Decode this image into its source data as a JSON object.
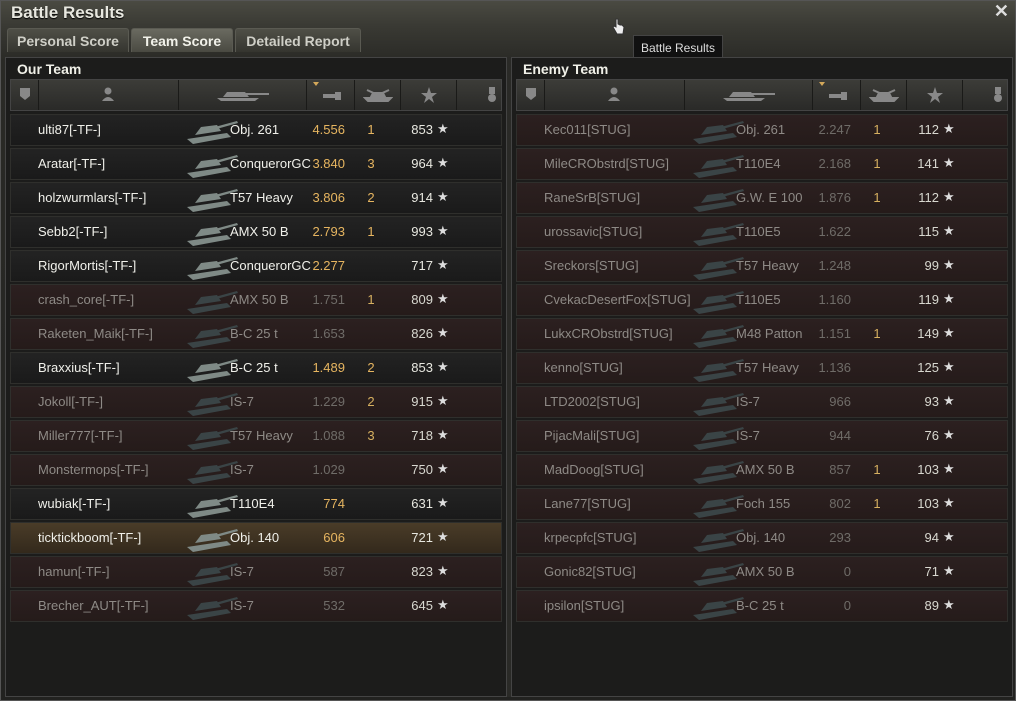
{
  "window": {
    "title": "Battle Results",
    "close_icon": "close-icon"
  },
  "tabs": [
    {
      "label": "Personal Score",
      "active": false
    },
    {
      "label": "Team Score",
      "active": true
    },
    {
      "label": "Detailed Report",
      "active": false
    }
  ],
  "tooltip": "Battle Results",
  "columns": {
    "icons": [
      "tier-badge-icon",
      "player-icon",
      "tank-icon",
      "damage-icon",
      "kills-icon",
      "xp-star-icon",
      "medal-icon"
    ],
    "sorted_by": "damage"
  },
  "our_team": {
    "title": "Our Team",
    "players": [
      {
        "name": "ulti87[-TF-]",
        "tank": "Obj. 261",
        "damage": "4.556",
        "kills": "1",
        "xp": "853",
        "state": "alive"
      },
      {
        "name": "Aratar[-TF-]",
        "tank": "ConquerorGC",
        "damage": "3.840",
        "kills": "3",
        "xp": "964",
        "state": "alive"
      },
      {
        "name": "holzwurmlars[-TF-]",
        "tank": "T57 Heavy",
        "damage": "3.806",
        "kills": "2",
        "xp": "914",
        "state": "alive"
      },
      {
        "name": "Sebb2[-TF-]",
        "tank": "AMX 50 B",
        "damage": "2.793",
        "kills": "1",
        "xp": "993",
        "state": "alive"
      },
      {
        "name": "RigorMortis[-TF-]",
        "tank": "ConquerorGC",
        "damage": "2.277",
        "kills": "",
        "xp": "717",
        "state": "alive"
      },
      {
        "name": "crash_core[-TF-]",
        "tank": "AMX 50 B",
        "damage": "1.751",
        "kills": "1",
        "xp": "809",
        "state": "dead"
      },
      {
        "name": "Raketen_Maik[-TF-]",
        "tank": "B-C 25 t",
        "damage": "1.653",
        "kills": "",
        "xp": "826",
        "state": "dead"
      },
      {
        "name": "Braxxius[-TF-]",
        "tank": "B-C 25 t",
        "damage": "1.489",
        "kills": "2",
        "xp": "853",
        "state": "alive"
      },
      {
        "name": "Jokoll[-TF-]",
        "tank": "IS-7",
        "damage": "1.229",
        "kills": "2",
        "xp": "915",
        "state": "dead"
      },
      {
        "name": "Miller777[-TF-]",
        "tank": "T57 Heavy",
        "damage": "1.088",
        "kills": "3",
        "xp": "718",
        "state": "dead"
      },
      {
        "name": "Monstermops[-TF-]",
        "tank": "IS-7",
        "damage": "1.029",
        "kills": "",
        "xp": "750",
        "state": "dead"
      },
      {
        "name": "wubiak[-TF-]",
        "tank": "T110E4",
        "damage": "774",
        "kills": "",
        "xp": "631",
        "state": "alive"
      },
      {
        "name": "ticktickboom[-TF-]",
        "tank": "Obj. 140",
        "damage": "606",
        "kills": "",
        "xp": "721",
        "state": "me"
      },
      {
        "name": "hamun[-TF-]",
        "tank": "IS-7",
        "damage": "587",
        "kills": "",
        "xp": "823",
        "state": "dead"
      },
      {
        "name": "Brecher_AUT[-TF-]",
        "tank": "IS-7",
        "damage": "532",
        "kills": "",
        "xp": "645",
        "state": "dead"
      }
    ]
  },
  "enemy_team": {
    "title": "Enemy Team",
    "players": [
      {
        "name": "Kec011[STUG]",
        "tank": "Obj. 261",
        "damage": "2.247",
        "kills": "1",
        "xp": "112",
        "state": "dead"
      },
      {
        "name": "MileCRObstrd[STUG]",
        "tank": "T110E4",
        "damage": "2.168",
        "kills": "1",
        "xp": "141",
        "state": "dead"
      },
      {
        "name": "RaneSrB[STUG]",
        "tank": "G.W. E 100",
        "damage": "1.876",
        "kills": "1",
        "xp": "112",
        "state": "dead"
      },
      {
        "name": "urossavic[STUG]",
        "tank": "T110E5",
        "damage": "1.622",
        "kills": "",
        "xp": "115",
        "state": "dead"
      },
      {
        "name": "Sreckors[STUG]",
        "tank": "T57 Heavy",
        "damage": "1.248",
        "kills": "",
        "xp": "99",
        "state": "dead"
      },
      {
        "name": "CvekacDesertFox[STUG]",
        "tank": "T110E5",
        "damage": "1.160",
        "kills": "",
        "xp": "119",
        "state": "dead"
      },
      {
        "name": "LukxCRObstrd[STUG]",
        "tank": "M48 Patton",
        "damage": "1.151",
        "kills": "1",
        "xp": "149",
        "state": "dead"
      },
      {
        "name": "kenno[STUG]",
        "tank": "T57 Heavy",
        "damage": "1.136",
        "kills": "",
        "xp": "125",
        "state": "dead"
      },
      {
        "name": "LTD2002[STUG]",
        "tank": "IS-7",
        "damage": "966",
        "kills": "",
        "xp": "93",
        "state": "dead"
      },
      {
        "name": "PijacMali[STUG]",
        "tank": "IS-7",
        "damage": "944",
        "kills": "",
        "xp": "76",
        "state": "dead"
      },
      {
        "name": "MadDoog[STUG]",
        "tank": "AMX 50 B",
        "damage": "857",
        "kills": "1",
        "xp": "103",
        "state": "dead"
      },
      {
        "name": "Lane77[STUG]",
        "tank": "Foch 155",
        "damage": "802",
        "kills": "1",
        "xp": "103",
        "state": "dead"
      },
      {
        "name": "krpecpfc[STUG]",
        "tank": "Obj. 140",
        "damage": "293",
        "kills": "",
        "xp": "94",
        "state": "dead"
      },
      {
        "name": "Gonic82[STUG]",
        "tank": "AMX 50 B",
        "damage": "0",
        "kills": "",
        "xp": "71",
        "state": "dead"
      },
      {
        "name": "ipsilon[STUG]",
        "tank": "B-C 25 t",
        "damage": "0",
        "kills": "",
        "xp": "89",
        "state": "dead"
      }
    ]
  },
  "colors": {
    "accent": "#e6b560",
    "dead_row": "#2c2020",
    "alive_text": "#f0f0ea",
    "dead_text": "#8e8a86"
  }
}
